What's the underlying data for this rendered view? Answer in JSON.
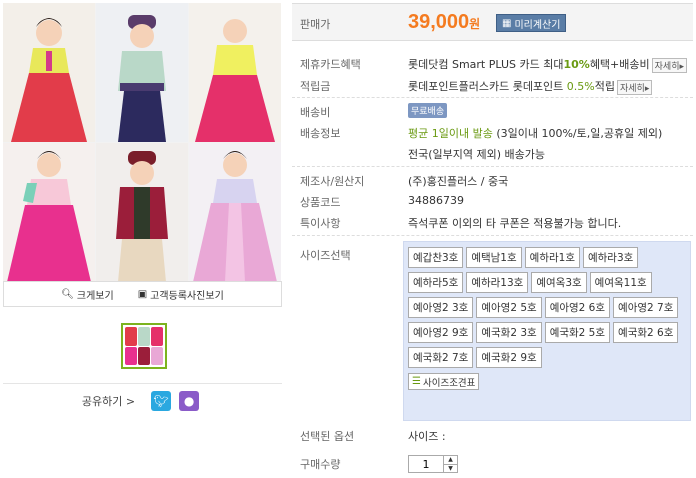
{
  "image": {
    "buttons": {
      "zoom_label": "크게보기",
      "photo_label": "고객등록사진보기"
    }
  },
  "share": {
    "label": "공유하기 >"
  },
  "price": {
    "label": "판매가",
    "amount": "39,000",
    "unit": "원",
    "calc_label": "미리계산기"
  },
  "benefits": {
    "card_label": "제휴카드혜택",
    "card_text_pre": "롯데닷컴 Smart PLUS 카드 최대",
    "card_percent": "10%",
    "card_text_post": "혜택+배송비",
    "more_label": "자세히▸",
    "points_label": "적립금",
    "points_text_pre": "롯데포인트플러스카드 롯데포인트 ",
    "points_percent": "0.5%",
    "points_text_post": "적립"
  },
  "shipping": {
    "fee_label": "배송비",
    "fee_badge": "무료배송",
    "info_label": "배송정보",
    "info_highlight": "평균 1일이내 발송",
    "info_text": " (3일이내 100%/토,일,공휴일 제외)",
    "info_line2": "전국(일부지역 제외) 배송가능"
  },
  "product": {
    "maker_label": "제조사/원산지",
    "maker_value": "(주)홍진플러스 / 중국",
    "code_label": "상품코드",
    "code_value": "34886739",
    "note_label": "특이사항",
    "note_value": "즉석쿠폰 이외의 타 쿠폰은 적용불가능 합니다."
  },
  "size": {
    "label": "사이즈선택",
    "options": [
      "예갑찬3호",
      "예택남1호",
      "예하라1호",
      "예하라3호",
      "예하라5호",
      "예하라13호",
      "예여옥3호",
      "예여옥11호",
      "예아영2 3호",
      "예아영2 5호",
      "예아영2 6호",
      "예아영2 7호",
      "예아영2 9호",
      "예국화2 3호",
      "예국화2 5호",
      "예국화2 6호",
      "예국화2 7호",
      "예국화2 9호"
    ],
    "chart_label": "사이즈조견표"
  },
  "selected": {
    "label": "선택된 옵션",
    "value": "사이즈 :"
  },
  "quantity": {
    "label": "구매수량",
    "value": "1"
  },
  "colors": {
    "price": "#f47b20",
    "accent_green": "#6a9a12",
    "size_box_bg": "#dfe7f8"
  }
}
